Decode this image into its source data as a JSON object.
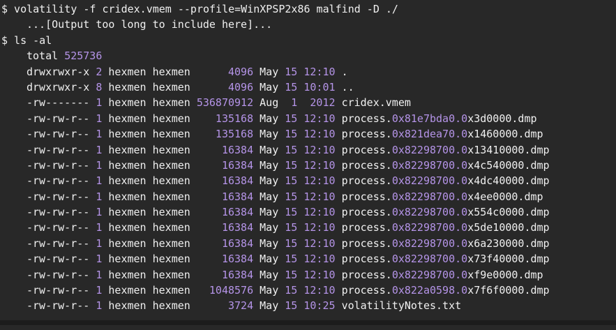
{
  "colors": {
    "background": "#282828",
    "text": "#f0f0f0",
    "number_highlight": "#b594e8"
  },
  "commands": {
    "volatility": "$ volatility -f cridex.vmem --profile=WinXPSP2x86 malfind -D ./",
    "volatility_output": "...[Output too long to include here]...",
    "ls": "$ ls -al"
  },
  "listing": {
    "total_label": "total",
    "total_value": "525736",
    "rows": [
      {
        "perms": "drwxrwxr-x",
        "links": "2",
        "owner": "hexmen",
        "group": "hexmen",
        "size": "4096",
        "month": "May",
        "day": "15",
        "time": "12:10",
        "name_prefix": ".",
        "name_hex1": "",
        "name_mid": "",
        "name_rest": ""
      },
      {
        "perms": "drwxrwxr-x",
        "links": "8",
        "owner": "hexmen",
        "group": "hexmen",
        "size": "4096",
        "month": "May",
        "day": "15",
        "time": "10:01",
        "name_prefix": "..",
        "name_hex1": "",
        "name_mid": "",
        "name_rest": ""
      },
      {
        "perms": "-rw-------",
        "links": "1",
        "owner": "hexmen",
        "group": "hexmen",
        "size": "536870912",
        "month": "Aug",
        "day": "1",
        "time": "2012",
        "name_prefix": "cridex.vmem",
        "name_hex1": "",
        "name_mid": "",
        "name_rest": ""
      },
      {
        "perms": "-rw-rw-r--",
        "links": "1",
        "owner": "hexmen",
        "group": "hexmen",
        "size": "135168",
        "month": "May",
        "day": "15",
        "time": "12:10",
        "name_prefix": "process.",
        "name_hex1": "0x81e7bda0.0",
        "name_mid": "",
        "name_rest": "x3d0000.dmp"
      },
      {
        "perms": "-rw-rw-r--",
        "links": "1",
        "owner": "hexmen",
        "group": "hexmen",
        "size": "135168",
        "month": "May",
        "day": "15",
        "time": "12:10",
        "name_prefix": "process.",
        "name_hex1": "0x821dea70.0",
        "name_mid": "",
        "name_rest": "x1460000.dmp"
      },
      {
        "perms": "-rw-rw-r--",
        "links": "1",
        "owner": "hexmen",
        "group": "hexmen",
        "size": "16384",
        "month": "May",
        "day": "15",
        "time": "12:10",
        "name_prefix": "process.",
        "name_hex1": "0x82298700.0",
        "name_mid": "",
        "name_rest": "x13410000.dmp"
      },
      {
        "perms": "-rw-rw-r--",
        "links": "1",
        "owner": "hexmen",
        "group": "hexmen",
        "size": "16384",
        "month": "May",
        "day": "15",
        "time": "12:10",
        "name_prefix": "process.",
        "name_hex1": "0x82298700.0",
        "name_mid": "",
        "name_rest": "x4c540000.dmp"
      },
      {
        "perms": "-rw-rw-r--",
        "links": "1",
        "owner": "hexmen",
        "group": "hexmen",
        "size": "16384",
        "month": "May",
        "day": "15",
        "time": "12:10",
        "name_prefix": "process.",
        "name_hex1": "0x82298700.0",
        "name_mid": "",
        "name_rest": "x4dc40000.dmp"
      },
      {
        "perms": "-rw-rw-r--",
        "links": "1",
        "owner": "hexmen",
        "group": "hexmen",
        "size": "16384",
        "month": "May",
        "day": "15",
        "time": "12:10",
        "name_prefix": "process.",
        "name_hex1": "0x82298700.0",
        "name_mid": "",
        "name_rest": "x4ee0000.dmp"
      },
      {
        "perms": "-rw-rw-r--",
        "links": "1",
        "owner": "hexmen",
        "group": "hexmen",
        "size": "16384",
        "month": "May",
        "day": "15",
        "time": "12:10",
        "name_prefix": "process.",
        "name_hex1": "0x82298700.0",
        "name_mid": "",
        "name_rest": "x554c0000.dmp"
      },
      {
        "perms": "-rw-rw-r--",
        "links": "1",
        "owner": "hexmen",
        "group": "hexmen",
        "size": "16384",
        "month": "May",
        "day": "15",
        "time": "12:10",
        "name_prefix": "process.",
        "name_hex1": "0x82298700.0",
        "name_mid": "",
        "name_rest": "x5de10000.dmp"
      },
      {
        "perms": "-rw-rw-r--",
        "links": "1",
        "owner": "hexmen",
        "group": "hexmen",
        "size": "16384",
        "month": "May",
        "day": "15",
        "time": "12:10",
        "name_prefix": "process.",
        "name_hex1": "0x82298700.0",
        "name_mid": "",
        "name_rest": "x6a230000.dmp"
      },
      {
        "perms": "-rw-rw-r--",
        "links": "1",
        "owner": "hexmen",
        "group": "hexmen",
        "size": "16384",
        "month": "May",
        "day": "15",
        "time": "12:10",
        "name_prefix": "process.",
        "name_hex1": "0x82298700.0",
        "name_mid": "",
        "name_rest": "x73f40000.dmp"
      },
      {
        "perms": "-rw-rw-r--",
        "links": "1",
        "owner": "hexmen",
        "group": "hexmen",
        "size": "16384",
        "month": "May",
        "day": "15",
        "time": "12:10",
        "name_prefix": "process.",
        "name_hex1": "0x82298700.0",
        "name_mid": "",
        "name_rest": "xf9e0000.dmp"
      },
      {
        "perms": "-rw-rw-r--",
        "links": "1",
        "owner": "hexmen",
        "group": "hexmen",
        "size": "1048576",
        "month": "May",
        "day": "15",
        "time": "12:10",
        "name_prefix": "process.",
        "name_hex1": "0x822a0598.0",
        "name_mid": "",
        "name_rest": "x7f6f0000.dmp"
      },
      {
        "perms": "-rw-rw-r--",
        "links": "1",
        "owner": "hexmen",
        "group": "hexmen",
        "size": "3724",
        "month": "May",
        "day": "15",
        "time": "10:25",
        "name_prefix": "volatilityNotes.txt",
        "name_hex1": "",
        "name_mid": "",
        "name_rest": ""
      }
    ]
  }
}
